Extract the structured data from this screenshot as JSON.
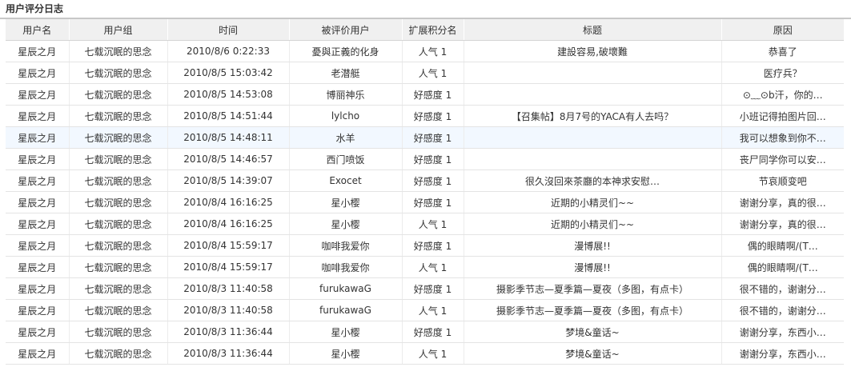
{
  "page_title": "用户评分日志",
  "colors": {
    "header_bg": "#f0f0f0",
    "highlight_row_bg": "#f2f8ff",
    "rule": "#c8c8c8"
  },
  "table": {
    "columns": [
      "用户名",
      "用户组",
      "时间",
      "被评价用户",
      "扩展积分名",
      "标题",
      "原因"
    ],
    "highlighted_row_index": 4,
    "rows": [
      [
        "星辰之月",
        "七载沉眠的思念",
        "2010/8/6 0:22:33",
        "憂與正義的化身",
        "人气 1",
        "建設容易,破壞難",
        "恭喜了"
      ],
      [
        "星辰之月",
        "七载沉眠的思念",
        "2010/8/5 15:03:42",
        "老潜艇",
        "人气 1",
        "",
        "医疗兵？"
      ],
      [
        "星辰之月",
        "七载沉眠的思念",
        "2010/8/5 14:53:08",
        "博丽神乐",
        "好感度 1",
        "",
        "⊙﹏⊙b汗，你的…"
      ],
      [
        "星辰之月",
        "七载沉眠的思念",
        "2010/8/5 14:51:44",
        "lylcho",
        "好感度 1",
        "【召集帖】8月7号的YACA有人去吗？",
        "小班记得拍图片回…"
      ],
      [
        "星辰之月",
        "七载沉眠的思念",
        "2010/8/5 14:48:11",
        "水羊",
        "好感度 1",
        "",
        "我可以想象到你不…"
      ],
      [
        "星辰之月",
        "七载沉眠的思念",
        "2010/8/5 14:46:57",
        "西门喷饭",
        "好感度 1",
        "",
        "丧尸同学你可以安…"
      ],
      [
        "星辰之月",
        "七载沉眠的思念",
        "2010/8/5 14:39:07",
        "Exocet",
        "好感度 1",
        "很久沒回來茶廳的本神求安慰…",
        "节哀顺变吧"
      ],
      [
        "星辰之月",
        "七载沉眠的思念",
        "2010/8/4 16:16:25",
        "星小樱",
        "好感度 1",
        "近期的小精灵们~~",
        "谢谢分享，真的很…"
      ],
      [
        "星辰之月",
        "七载沉眠的思念",
        "2010/8/4 16:16:25",
        "星小樱",
        "人气 1",
        "近期的小精灵们~~",
        "谢谢分享，真的很…"
      ],
      [
        "星辰之月",
        "七载沉眠的思念",
        "2010/8/4 15:59:17",
        "咖啡我爱你",
        "好感度 1",
        "漫博展!!",
        "偶的眼睛啊/(T…"
      ],
      [
        "星辰之月",
        "七载沉眠的思念",
        "2010/8/4 15:59:17",
        "咖啡我爱你",
        "人气 1",
        "漫博展!!",
        "偶的眼睛啊/(T…"
      ],
      [
        "星辰之月",
        "七载沉眠的思念",
        "2010/8/3 11:40:58",
        "furukawaG",
        "好感度 1",
        "摄影季节志—夏季篇—夏夜（多图，有点卡）",
        "很不错的，谢谢分…"
      ],
      [
        "星辰之月",
        "七载沉眠的思念",
        "2010/8/3 11:40:58",
        "furukawaG",
        "人气 1",
        "摄影季节志—夏季篇—夏夜（多图，有点卡）",
        "很不错的，谢谢分…"
      ],
      [
        "星辰之月",
        "七载沉眠的思念",
        "2010/8/3 11:36:44",
        "星小樱",
        "好感度 1",
        "梦境&童话~",
        "谢谢分享，东西小…"
      ],
      [
        "星辰之月",
        "七载沉眠的思念",
        "2010/8/3 11:36:44",
        "星小樱",
        "人气 1",
        "梦境&童话~",
        "谢谢分享，东西小…"
      ]
    ]
  }
}
